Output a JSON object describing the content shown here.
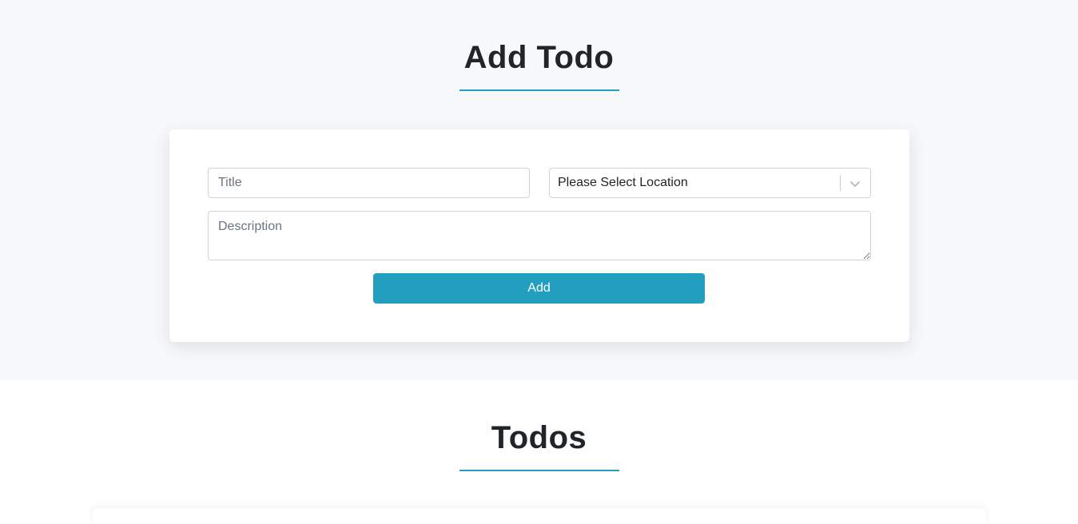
{
  "add_section": {
    "heading": "Add Todo",
    "accent_color": "#229fbf",
    "form": {
      "title_placeholder": "Title",
      "title_value": "",
      "location_selected": "Please Select Location",
      "description_placeholder": "Description",
      "description_value": "",
      "add_label": "Add"
    }
  },
  "todos_section": {
    "heading": "Todos"
  },
  "icons": {
    "select_toggle": "chevron-down-icon"
  }
}
